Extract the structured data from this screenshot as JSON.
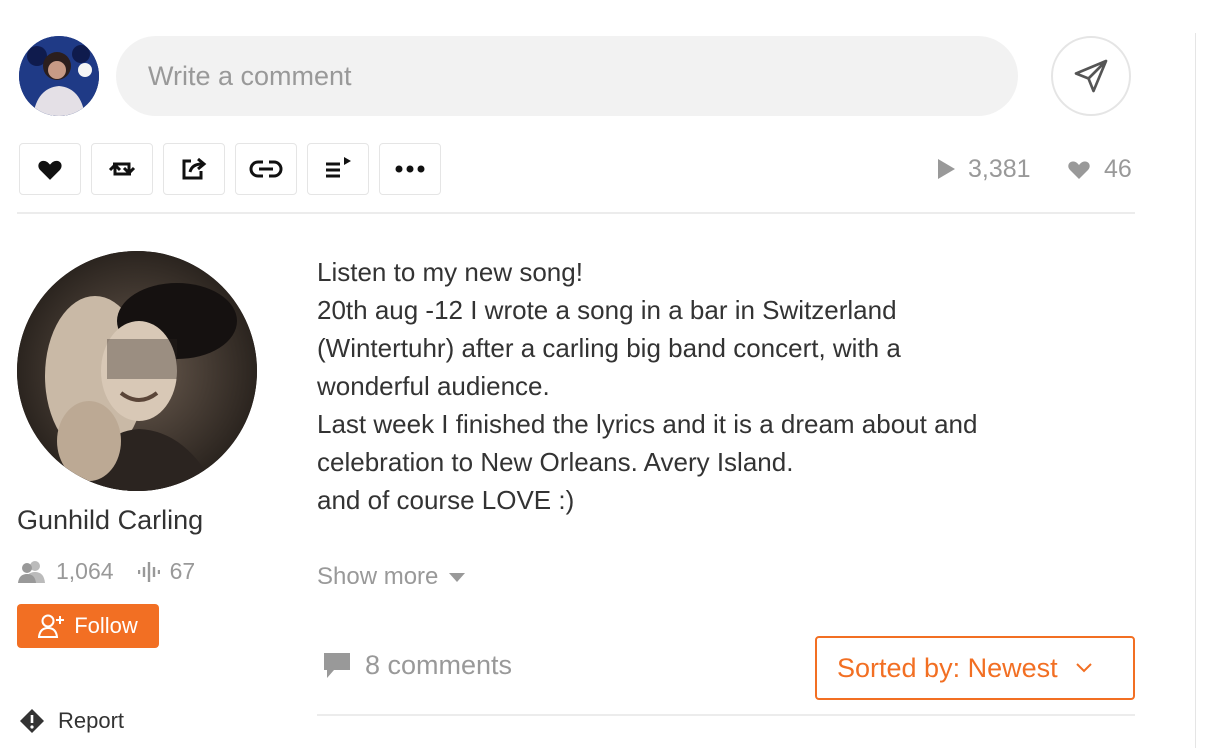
{
  "comment_bar": {
    "placeholder": "Write a comment"
  },
  "actions": {
    "items": [
      {
        "name": "like",
        "icon": "heart-icon"
      },
      {
        "name": "repost",
        "icon": "repost-icon"
      },
      {
        "name": "share",
        "icon": "share-icon"
      },
      {
        "name": "copy-link",
        "icon": "link-icon"
      },
      {
        "name": "add-to-next-up",
        "icon": "queue-icon"
      },
      {
        "name": "more",
        "icon": "more-icon"
      }
    ]
  },
  "stats": {
    "plays": "3,381",
    "likes": "46"
  },
  "uploader": {
    "name": "Gunhild Carling",
    "followers": "1,064",
    "tracks": "67",
    "follow_label": "Follow",
    "report_label": "Report"
  },
  "description": {
    "lines": [
      "Listen to my new song!",
      "20th aug -12 I wrote a song in a bar in Switzerland",
      "(Wintertuhr) after a carling big band concert, with a",
      "wonderful audience.",
      "Last week I finished the lyrics and it is a dream about and",
      "celebration to New Orleans. Avery Island.",
      "and of course LOVE :)"
    ],
    "show_more_label": "Show more"
  },
  "comments": {
    "count_label": "8 comments",
    "sort_label": "Sorted by: Newest"
  },
  "colors": {
    "accent": "#f26f23",
    "muted": "#999999",
    "text": "#333333"
  }
}
